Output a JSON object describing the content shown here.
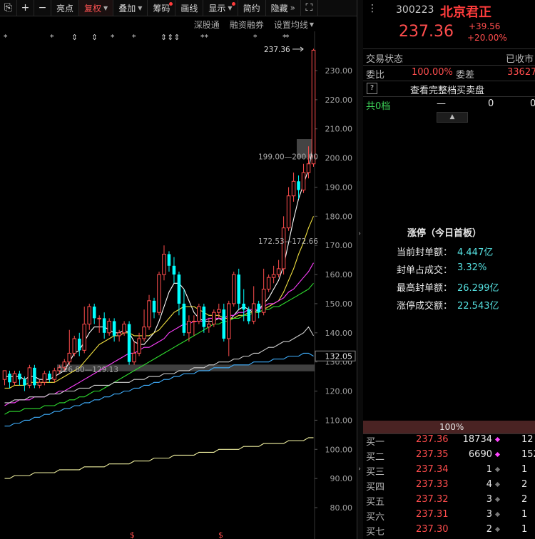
{
  "toolbar": {
    "items": [
      {
        "label": "",
        "icon": "lock-icon"
      },
      {
        "label": "+",
        "icon": "zoom-in-icon"
      },
      {
        "label": "−",
        "icon": "zoom-out-icon"
      },
      {
        "label": "亮点"
      },
      {
        "label": "复权",
        "active": true,
        "dropdown": true
      },
      {
        "label": "叠加",
        "dropdown": true
      },
      {
        "label": "筹码",
        "badge": true
      },
      {
        "label": "画线"
      },
      {
        "label": "显示",
        "dropdown": true,
        "badge": true
      },
      {
        "label": "简约"
      },
      {
        "label": "隐藏",
        "dropdown_glyph": "»"
      },
      {
        "label": "",
        "icon": "fullscreen-icon"
      }
    ]
  },
  "subbar": {
    "items": [
      "深股通",
      "融资融券",
      "设置均线"
    ]
  },
  "stock": {
    "code": "300223",
    "name": "北京君正",
    "price": "237.36",
    "change": "+39.56",
    "change_pct": "+20.00%"
  },
  "trade_status": {
    "label": "交易状态",
    "value": "已收市"
  },
  "weibi": {
    "label": "委比",
    "value": "100.00%",
    "label2": "委差",
    "value2": "33627"
  },
  "view_full_book": {
    "icon_label": "?",
    "label": "查看完整档买卖盘"
  },
  "sell_summary": {
    "label": "共0档",
    "dash": "—",
    "v1": "0",
    "v2": "0"
  },
  "limit_up": {
    "title": "涨停（今日首板）",
    "rows": [
      {
        "label": "当前封单额：",
        "value": "4.447亿"
      },
      {
        "label": "封单占成交：",
        "value": "3.32%"
      },
      {
        "label": "最高封单额：",
        "value": "26.299亿"
      },
      {
        "label": "涨停成交额：",
        "value": "22.543亿"
      }
    ]
  },
  "buy_ratio": "100%",
  "order_book": [
    {
      "label": "买一",
      "price": "237.36",
      "vol": "18734",
      "dot": "#ff44ff",
      "extra": "12"
    },
    {
      "label": "买二",
      "price": "237.35",
      "vol": "6690",
      "dot": "#ff44ff",
      "extra": "152"
    },
    {
      "label": "买三",
      "price": "237.34",
      "vol": "1",
      "dot": "#777777",
      "extra": "1"
    },
    {
      "label": "买四",
      "price": "237.33",
      "vol": "4",
      "dot": "#777777",
      "extra": "2"
    },
    {
      "label": "买五",
      "price": "237.32",
      "vol": "3",
      "dot": "#777777",
      "extra": "2"
    },
    {
      "label": "买六",
      "price": "237.31",
      "vol": "3",
      "dot": "#777777",
      "extra": "1"
    },
    {
      "label": "买七",
      "price": "237.30",
      "vol": "2",
      "dot": "#777777",
      "extra": "1"
    }
  ],
  "chart_data": {
    "type": "candlestick",
    "y_axis": {
      "min": 80,
      "max": 240,
      "ticks": [
        "230.00",
        "220.00",
        "210.00",
        "200.00",
        "190.00",
        "180.00",
        "170.00",
        "160.00",
        "150.00",
        "140.00",
        "130.00",
        "120.00",
        "110.00",
        "100.00",
        "90.00",
        "80.00"
      ]
    },
    "price_tags": [
      {
        "label": "237.36",
        "value": 237.36,
        "arrow": true
      },
      {
        "label": "199.00—200.00",
        "value": 200.5
      },
      {
        "label": "172.53—172.66",
        "value": 171.5
      },
      {
        "label": "126.80—129.13",
        "value": 127.5
      }
    ],
    "highlight_boxes": [
      {
        "from": 200.0,
        "to": 206.5
      },
      {
        "from": 126.8,
        "to": 129.1
      }
    ],
    "current_price_label": "132.05",
    "current_price_value": 132.05,
    "star_markers": [
      "*",
      "*",
      "⇕",
      "⇕",
      "*",
      "*",
      "⇕⇕⇕",
      "**",
      "*",
      "*",
      "*"
    ],
    "candles": [
      [
        124,
        127,
        122,
        126
      ],
      [
        126,
        123,
        121,
        127
      ],
      [
        123,
        126,
        122,
        127
      ],
      [
        126,
        124,
        122,
        127
      ],
      [
        124,
        122,
        120,
        125
      ],
      [
        122,
        128,
        121,
        129
      ],
      [
        128,
        122,
        121,
        129
      ],
      [
        122,
        123,
        121,
        124
      ],
      [
        123,
        126,
        122,
        127
      ],
      [
        126,
        124,
        123,
        127
      ],
      [
        124,
        127,
        123,
        128
      ],
      [
        127,
        128,
        126,
        129
      ],
      [
        128,
        130,
        127,
        131
      ],
      [
        130,
        133,
        129,
        141
      ],
      [
        133,
        138,
        132,
        139
      ],
      [
        138,
        134,
        132,
        140
      ],
      [
        134,
        143,
        133,
        149
      ],
      [
        143,
        149,
        141,
        150
      ],
      [
        149,
        145,
        143,
        150
      ],
      [
        145,
        145,
        140,
        146
      ],
      [
        145,
        140,
        138,
        147
      ],
      [
        140,
        144,
        139,
        145
      ],
      [
        144,
        139,
        137,
        145
      ],
      [
        139,
        140,
        137,
        141
      ],
      [
        140,
        143,
        139,
        144
      ],
      [
        143,
        130,
        129,
        144
      ],
      [
        130,
        133,
        129,
        137
      ],
      [
        133,
        138,
        132,
        140
      ],
      [
        138,
        142,
        137,
        148
      ],
      [
        142,
        151,
        141,
        153
      ],
      [
        151,
        147,
        145,
        152
      ],
      [
        147,
        160,
        146,
        161
      ],
      [
        160,
        167,
        158,
        170
      ],
      [
        167,
        163,
        161,
        168
      ],
      [
        163,
        160,
        157,
        166
      ],
      [
        160,
        150,
        146,
        161
      ],
      [
        150,
        140,
        139,
        155
      ],
      [
        140,
        144,
        137,
        146
      ],
      [
        144,
        144,
        139,
        146
      ],
      [
        144,
        149,
        143,
        150
      ],
      [
        149,
        142,
        140,
        150
      ],
      [
        142,
        143,
        140,
        145
      ],
      [
        143,
        147,
        142,
        148
      ],
      [
        147,
        148,
        145,
        150
      ],
      [
        148,
        138,
        137,
        150
      ],
      [
        138,
        150,
        132,
        151
      ],
      [
        150,
        160,
        149,
        161
      ],
      [
        160,
        150,
        148,
        162
      ],
      [
        150,
        148,
        144,
        155
      ],
      [
        148,
        144,
        143,
        149
      ],
      [
        144,
        150,
        143,
        156
      ],
      [
        150,
        147,
        145,
        151
      ],
      [
        147,
        155,
        146,
        162
      ],
      [
        155,
        159,
        154,
        160
      ],
      [
        159,
        160,
        157,
        163
      ],
      [
        160,
        162,
        159,
        165
      ],
      [
        162,
        176,
        160,
        180
      ],
      [
        176,
        187,
        175,
        190
      ],
      [
        187,
        192,
        185,
        195
      ],
      [
        192,
        189,
        186,
        194
      ],
      [
        189,
        195,
        188,
        198
      ],
      [
        195,
        198,
        193,
        204
      ],
      [
        198,
        237,
        197,
        237.5
      ]
    ],
    "ma_lines": [
      {
        "color": "#ffffff",
        "values": [
          125,
          125,
          125,
          125,
          124,
          125,
          125,
          124,
          124,
          124,
          125,
          126,
          127,
          130,
          133,
          134,
          137,
          140,
          142,
          142,
          142,
          141,
          140,
          140,
          141,
          140,
          137,
          136,
          136,
          138,
          140,
          144,
          149,
          154,
          157,
          157,
          155,
          151,
          147,
          145,
          144,
          144,
          144,
          145,
          144,
          144,
          146,
          148,
          149,
          148,
          147,
          148,
          150,
          152,
          155,
          158,
          163,
          171,
          179,
          186,
          191,
          196,
          205
        ]
      },
      {
        "color": "#f0e040",
        "values": [
          121,
          121,
          122,
          122,
          122,
          123,
          123,
          123,
          123,
          123,
          123,
          124,
          125,
          126,
          127,
          128,
          130,
          132,
          134,
          136,
          137,
          138,
          139,
          139,
          140,
          140,
          139,
          139,
          139,
          139,
          140,
          141,
          143,
          145,
          147,
          148,
          149,
          149,
          149,
          148,
          147,
          146,
          146,
          146,
          145,
          145,
          145,
          146,
          146,
          147,
          147,
          147,
          148,
          149,
          150,
          151,
          154,
          158,
          162,
          167,
          171,
          176,
          180
        ]
      },
      {
        "color": "#ff40ff",
        "values": [
          115,
          116,
          116,
          117,
          117,
          117,
          118,
          118,
          118,
          119,
          119,
          120,
          120,
          121,
          122,
          123,
          124,
          125,
          126,
          127,
          128,
          129,
          130,
          131,
          132,
          133,
          133,
          134,
          135,
          135,
          136,
          137,
          138,
          140,
          141,
          142,
          143,
          143,
          144,
          144,
          144,
          145,
          145,
          145,
          145,
          146,
          146,
          147,
          147,
          148,
          148,
          148,
          149,
          150,
          150,
          151,
          152,
          154,
          155,
          157,
          159,
          161,
          164
        ]
      },
      {
        "color": "#30e030",
        "values": [
          112,
          113,
          113,
          113,
          114,
          114,
          114,
          114,
          115,
          115,
          115,
          116,
          116,
          117,
          117,
          118,
          118,
          119,
          120,
          120,
          121,
          122,
          123,
          124,
          125,
          126,
          127,
          128,
          129,
          130,
          131,
          132,
          133,
          134,
          135,
          136,
          137,
          138,
          139,
          140,
          141,
          142,
          143,
          143,
          144,
          144,
          145,
          145,
          146,
          146,
          147,
          147,
          148,
          148,
          149,
          149,
          150,
          151,
          152,
          153,
          154,
          155,
          157
        ]
      },
      {
        "color": "#cfcfcf",
        "values": [
          116,
          116,
          117,
          117,
          117,
          118,
          118,
          118,
          118,
          119,
          119,
          119,
          120,
          120,
          120,
          121,
          121,
          121,
          122,
          122,
          122,
          122,
          123,
          123,
          123,
          123,
          124,
          124,
          124,
          125,
          125,
          125,
          126,
          126,
          126,
          127,
          127,
          127,
          128,
          128,
          128,
          129,
          129,
          130,
          130,
          130,
          131,
          131,
          132,
          132,
          133,
          133,
          134,
          135,
          135,
          136,
          137,
          137,
          138,
          139,
          140,
          142,
          139
        ]
      },
      {
        "color": "#40b0ff",
        "values": [
          108,
          108,
          109,
          109,
          110,
          110,
          111,
          111,
          112,
          112,
          113,
          113,
          114,
          114,
          115,
          115,
          116,
          116,
          117,
          117,
          118,
          118,
          119,
          119,
          120,
          120,
          121,
          121,
          122,
          122,
          123,
          123,
          124,
          124,
          125,
          125,
          126,
          126,
          126,
          127,
          127,
          127,
          128,
          128,
          128,
          128,
          129,
          129,
          129,
          129,
          130,
          130,
          130,
          130,
          131,
          131,
          131,
          132,
          132,
          132,
          133,
          133,
          132
        ]
      },
      {
        "color": "#f0f0a0",
        "values": [
          90,
          90,
          91,
          91,
          91,
          91,
          92,
          92,
          92,
          92,
          92,
          93,
          93,
          93,
          93,
          93,
          94,
          94,
          94,
          94,
          94,
          95,
          95,
          95,
          95,
          95,
          96,
          96,
          96,
          96,
          97,
          97,
          97,
          97,
          98,
          98,
          98,
          98,
          98,
          99,
          99,
          99,
          99,
          100,
          100,
          100,
          100,
          100,
          101,
          101,
          101,
          101,
          102,
          102,
          102,
          102,
          102,
          103,
          103,
          103,
          103,
          104,
          104
        ]
      }
    ]
  }
}
